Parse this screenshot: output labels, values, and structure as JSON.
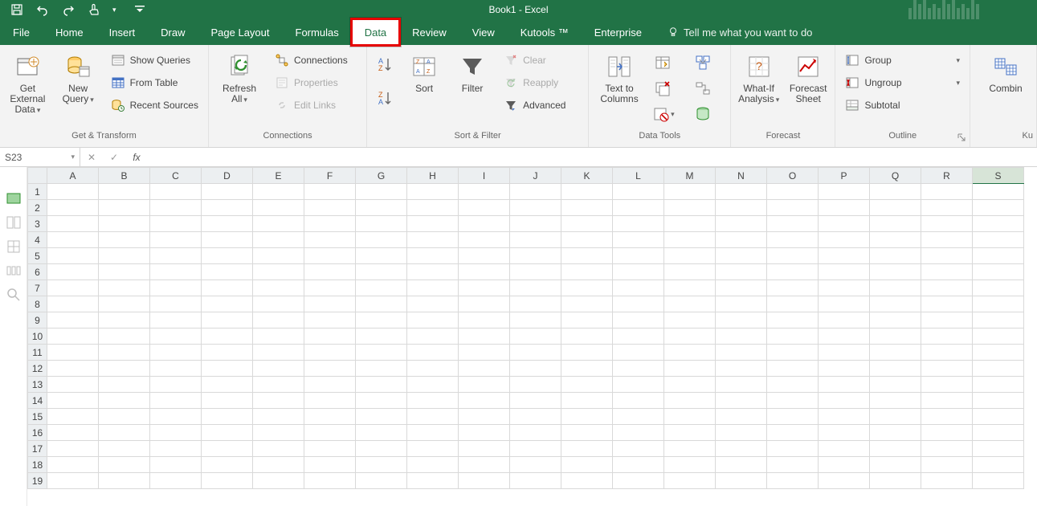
{
  "title": "Book1 - Excel",
  "qat": {
    "save": "",
    "undo": "",
    "redo": "",
    "touchmode": "",
    "more": ""
  },
  "tabs": [
    "File",
    "Home",
    "Insert",
    "Draw",
    "Page Layout",
    "Formulas",
    "Data",
    "Review",
    "View",
    "Kutools ™",
    "Enterprise"
  ],
  "active_tab": "Data",
  "highlighted_tab": "Data",
  "tellme": "Tell me what you want to do",
  "ribbon": {
    "get_transform": {
      "label": "Get & Transform",
      "get_external": "Get External\nData",
      "new_query": "New\nQuery",
      "show_queries": "Show Queries",
      "from_table": "From Table",
      "recent_sources": "Recent Sources"
    },
    "connections": {
      "label": "Connections",
      "refresh_all": "Refresh\nAll",
      "connections": "Connections",
      "properties": "Properties",
      "edit_links": "Edit Links"
    },
    "sort_filter": {
      "label": "Sort & Filter",
      "sort": "Sort",
      "filter": "Filter",
      "clear": "Clear",
      "reapply": "Reapply",
      "advanced": "Advanced"
    },
    "data_tools": {
      "label": "Data Tools",
      "text_to_columns": "Text to\nColumns"
    },
    "forecast": {
      "label": "Forecast",
      "whatif": "What-If\nAnalysis",
      "forecast_sheet": "Forecast\nSheet"
    },
    "outline": {
      "label": "Outline",
      "group": "Group",
      "ungroup": "Ungroup",
      "subtotal": "Subtotal"
    },
    "kutools": {
      "label": "Ku",
      "combine": "Combin"
    }
  },
  "namebox": "S23",
  "columns": [
    "A",
    "B",
    "C",
    "D",
    "E",
    "F",
    "G",
    "H",
    "I",
    "J",
    "K",
    "L",
    "M",
    "N",
    "O",
    "P",
    "Q",
    "R",
    "S"
  ],
  "selected_column": "S",
  "rows": [
    1,
    2,
    3,
    4,
    5,
    6,
    7,
    8,
    9,
    10,
    11,
    12,
    13,
    14,
    15,
    16,
    17,
    18,
    19
  ]
}
